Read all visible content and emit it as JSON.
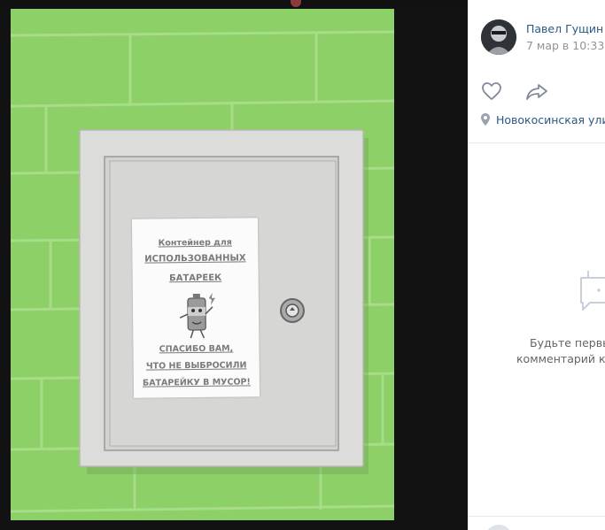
{
  "post": {
    "author": "Павел Гущин",
    "date": "7 мар в 10:33",
    "location": "Новокосинская улица",
    "icons": [
      "heart-icon",
      "share-icon",
      "location-pin-icon"
    ]
  },
  "comments": {
    "empty_line1": "Будьте первым, кто оставит",
    "empty_line2": "комментарий к этой записи."
  },
  "photo_sign": {
    "line1": "Контейнер для",
    "line2": "ИСПОЛЬЗОВАННЫХ",
    "line3": "БАТАРЕЕК",
    "line4": "СПАСИБО ВАМ,",
    "line5": "ЧТО НЕ ВЫБРОСИЛИ",
    "line6": "БАТАРЕЙКУ В МУСОР!"
  },
  "colors": {
    "link": "#2a5885",
    "muted": "#939393",
    "wall": "#8fcf68",
    "box": "#d9d9d9"
  }
}
